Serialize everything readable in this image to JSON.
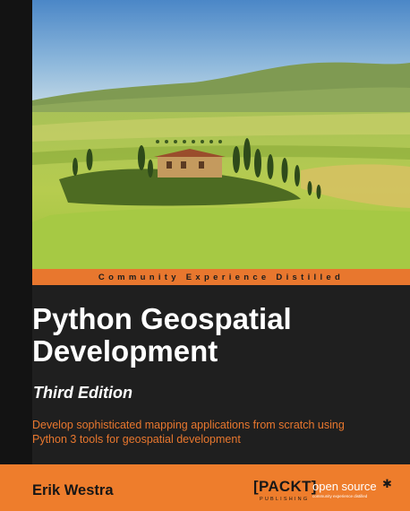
{
  "cover": {
    "tagline": "Community Experience Distilled",
    "title_lines": [
      "Python Geospatial",
      "Development"
    ],
    "edition": "Third Edition",
    "subtitle_lines": [
      "Develop sophisticated mapping applications from scratch using",
      "Python 3 tools for geospatial development"
    ],
    "author": "Erik Westra",
    "publisher": {
      "name": "PACKT",
      "sub": "PUBLISHING",
      "open_source": "open source",
      "open_source_tagline": "community experience distilled"
    },
    "image": "tuscan-landscape-photo",
    "colors": {
      "accent": "#e8772e",
      "background": "#1f1f1f",
      "title": "#ffffff"
    }
  }
}
